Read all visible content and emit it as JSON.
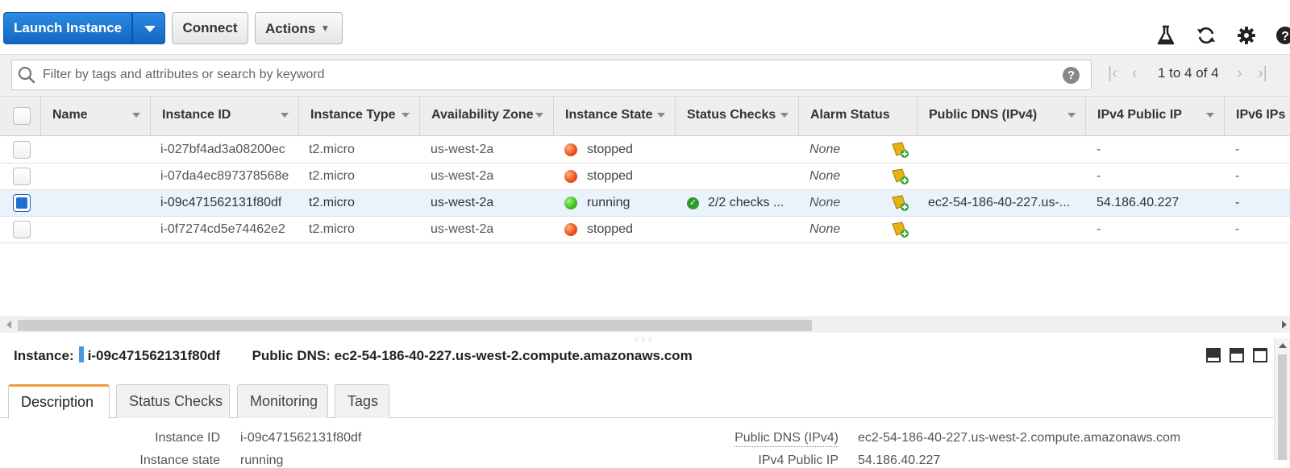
{
  "toolbar": {
    "launch_label": "Launch Instance",
    "connect_label": "Connect",
    "actions_label": "Actions",
    "icons": [
      "flask-icon",
      "refresh-icon",
      "gear-icon",
      "help-icon"
    ]
  },
  "search": {
    "placeholder": "Filter by tags and attributes or search by keyword",
    "value": "",
    "help": "?"
  },
  "pagination": {
    "text": "1 to 4 of 4"
  },
  "table": {
    "columns": [
      "Name",
      "Instance ID",
      "Instance Type",
      "Availability Zone",
      "Instance State",
      "Status Checks",
      "Alarm Status",
      "Public DNS (IPv4)",
      "IPv4 Public IP",
      "IPv6 IPs"
    ],
    "rows": [
      {
        "name": "",
        "id": "i-027bf4ad3a08200ec",
        "type": "t2.micro",
        "zone": "us-west-2a",
        "state": "stopped",
        "checks": "",
        "alarm": "None",
        "dns": "",
        "ip": "-",
        "ipv6": "-",
        "selected": false
      },
      {
        "name": "",
        "id": "i-07da4ec897378568e",
        "type": "t2.micro",
        "zone": "us-west-2a",
        "state": "stopped",
        "checks": "",
        "alarm": "None",
        "dns": "",
        "ip": "-",
        "ipv6": "-",
        "selected": false
      },
      {
        "name": "",
        "id": "i-09c471562131f80df",
        "type": "t2.micro",
        "zone": "us-west-2a",
        "state": "running",
        "checks": "2/2 checks ...",
        "alarm": "None",
        "dns": "ec2-54-186-40-227.us-...",
        "ip": "54.186.40.227",
        "ipv6": "-",
        "selected": true
      },
      {
        "name": "",
        "id": "i-0f7274cd5e74462e2",
        "type": "t2.micro",
        "zone": "us-west-2a",
        "state": "stopped",
        "checks": "",
        "alarm": "None",
        "dns": "",
        "ip": "-",
        "ipv6": "-",
        "selected": false
      }
    ]
  },
  "detail": {
    "instance_label": "Instance:",
    "instance_id": "i-09c471562131f80df",
    "dns_label": "Public DNS:",
    "dns_value": "ec2-54-186-40-227.us-west-2.compute.amazonaws.com",
    "tabs": [
      "Description",
      "Status Checks",
      "Monitoring",
      "Tags"
    ],
    "active_tab": "Description",
    "fields_left": [
      {
        "label": "Instance ID",
        "value": "i-09c471562131f80df"
      },
      {
        "label": "Instance state",
        "value": "running"
      }
    ],
    "fields_right": [
      {
        "label": "Public DNS (IPv4)",
        "value": "ec2-54-186-40-227.us-west-2.compute.amazonaws.com"
      },
      {
        "label": "IPv4 Public IP",
        "value": "54.186.40.227"
      }
    ]
  },
  "colors": {
    "primary_button": "#1466c4",
    "stopped": "#ee4b16",
    "running": "#3cbc1d",
    "selected_row": "#eaf3fc",
    "active_tab_accent": "#f39a3b"
  }
}
